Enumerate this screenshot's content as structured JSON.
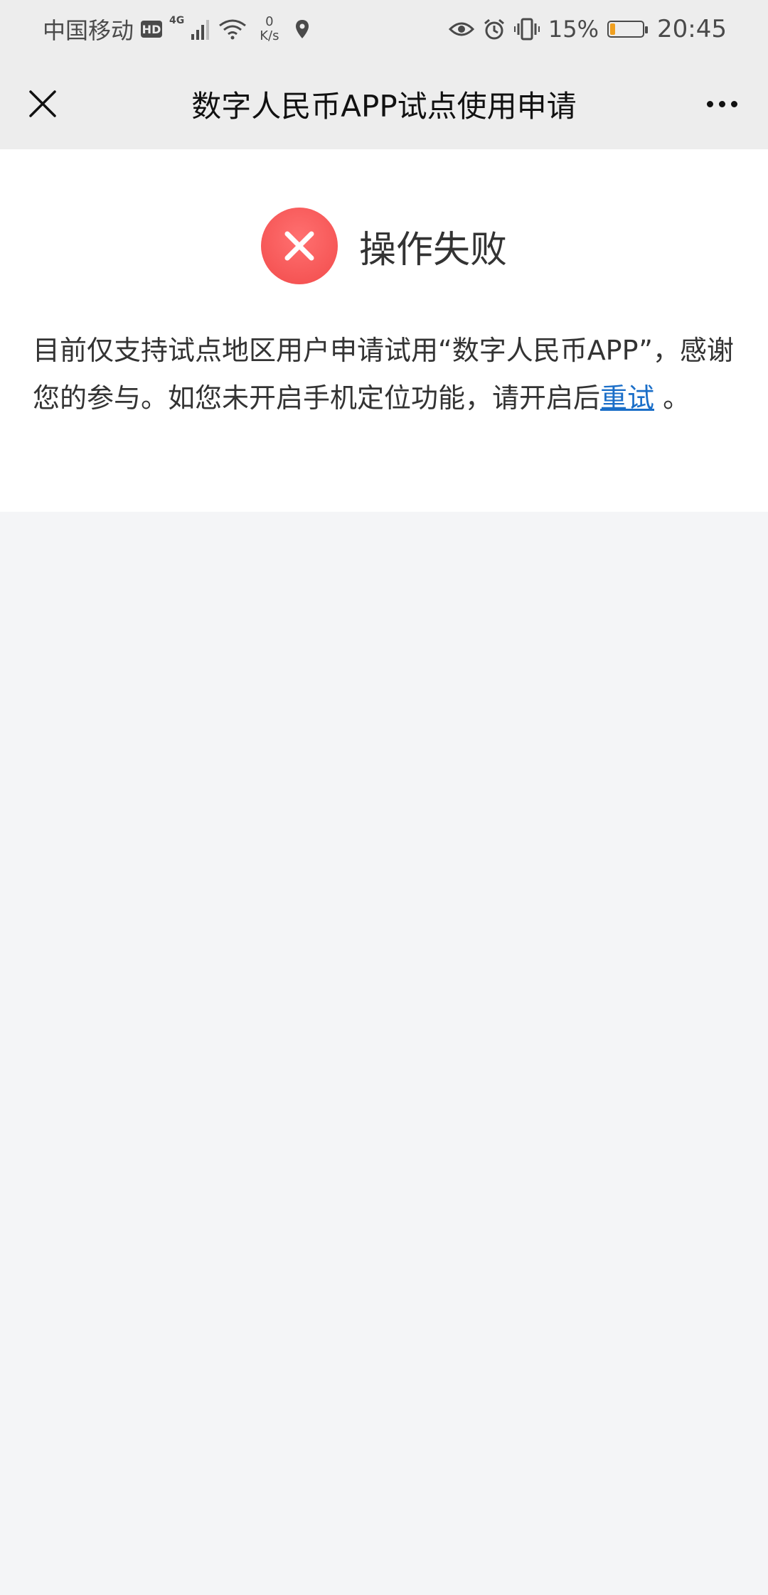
{
  "status_bar": {
    "carrier": "中国移动",
    "hd": "HD",
    "network": "4G",
    "speed_value": "0",
    "speed_unit": "K/s",
    "battery_percent_text": "15%",
    "battery_level": 0.15,
    "time": "20:45",
    "battery_color": "#f0a020"
  },
  "nav": {
    "title": "数字人民币APP试点使用申请",
    "close_icon": "close-icon",
    "more_icon": "more-icon"
  },
  "result": {
    "status_icon": "error-x-icon",
    "title": "操作失败",
    "message_prefix": "目前仅支持试点地区用户申请试用“数字人民币APP”，感谢您的参与。如您未开启手机定位功能，请开启后",
    "retry_label": "重试",
    "message_suffix": " 。",
    "accent_color": "#f24b4b",
    "link_color": "#1a6ec8"
  }
}
